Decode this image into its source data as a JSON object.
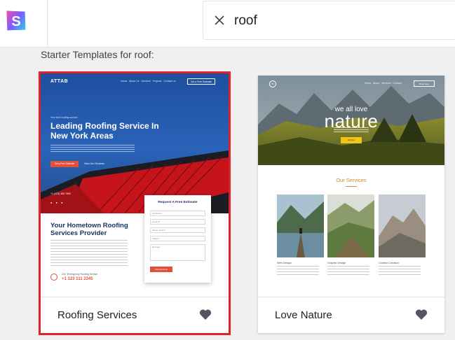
{
  "search": {
    "value": "roof"
  },
  "heading": "Starter Templates for roof:",
  "colors": {
    "selected_outline": "#e0202a",
    "accent_orange": "#e0503a",
    "nature_gold": "#d08a2a"
  },
  "cards": [
    {
      "title": "Roofing Services",
      "selected": true,
      "favorite_icon": "heart-icon",
      "preview": {
        "brand": "ATTAB",
        "nav_links": [
          "Home",
          "About Us",
          "Services",
          "Projects",
          "Contact Us"
        ],
        "nav_button": "Get a Free Estimate",
        "tagline": "Your best roofing service",
        "headline": "Leading Roofing Service In New York Areas",
        "cta_primary": "Get a Free Estimate",
        "cta_secondary": "View Our Services",
        "phone_top": "+1 (123) 456 7890",
        "section_title": "Your Hometown Roofing Services Provider",
        "call_label": "24/7 Emergency Roofing Service",
        "call_number": "+1 123 111 2345",
        "form_title": "Request A Free Estimate",
        "form_fields": [
          "Full Name*",
          "Email ID*",
          "Phone number*",
          "Subject*"
        ],
        "form_message": "Message",
        "form_submit": "Send Request"
      }
    },
    {
      "title": "Love Nature",
      "selected": false,
      "favorite_icon": "heart-icon",
      "preview": {
        "logo": "N",
        "nav_links": [
          "Home",
          "About",
          "Services",
          "Contact"
        ],
        "nav_button": "Book Now",
        "tagline": "we all love",
        "headline": "nature",
        "button": "Explore",
        "services_title": "Our Services",
        "services": [
          "Web Design",
          "Graphic Design",
          "Content Creation"
        ]
      }
    }
  ]
}
